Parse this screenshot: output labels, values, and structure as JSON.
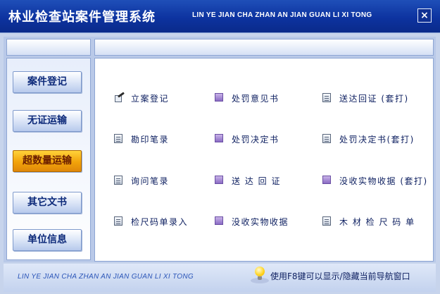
{
  "window": {
    "title_cn": "林业检查站案件管理系统",
    "title_en": "LIN YE JIAN CHA ZHAN AN JIAN GUAN LI XI TONG",
    "close_label": "×"
  },
  "nav": {
    "items": [
      {
        "label": "案件登记",
        "active": false
      },
      {
        "label": "无证运输",
        "active": false
      },
      {
        "label": "超数量运输",
        "active": true
      },
      {
        "label": "其它文书",
        "active": false
      },
      {
        "label": "单位信息",
        "active": false
      }
    ]
  },
  "main": {
    "items": [
      {
        "label": "立案登记",
        "icon": "pen-doc-icon"
      },
      {
        "label": "处罚意见书",
        "icon": "purple-doc-icon"
      },
      {
        "label": "送达回证 (套打)",
        "icon": "doc-icon"
      },
      {
        "label": "勘印笔录",
        "icon": "doc-icon"
      },
      {
        "label": "处罚决定书",
        "icon": "purple-doc-icon"
      },
      {
        "label": "处罚决定书(套打)",
        "icon": "doc-icon"
      },
      {
        "label": "询问笔录",
        "icon": "doc-icon"
      },
      {
        "label": "送 达 回 证",
        "icon": "purple-doc-icon"
      },
      {
        "label": "没收实物收据 (套打)",
        "icon": "purple-doc-icon"
      },
      {
        "label": "检尺码单录入",
        "icon": "doc-icon"
      },
      {
        "label": "没收实物收据",
        "icon": "purple-doc-icon"
      },
      {
        "label": "木 材 检 尺 码 单",
        "icon": "doc-icon"
      }
    ]
  },
  "footer": {
    "title_en": "LIN YE JIAN CHA ZHAN AN JIAN GUAN LI XI TONG",
    "tip": "使用F8键可以显示/隐藏当前导航窗口",
    "tip_icon": "lightbulb-icon"
  },
  "colors": {
    "titlebar": "#0d33a0",
    "active_nav": "#f2a30a",
    "text": "#0d1f60"
  }
}
